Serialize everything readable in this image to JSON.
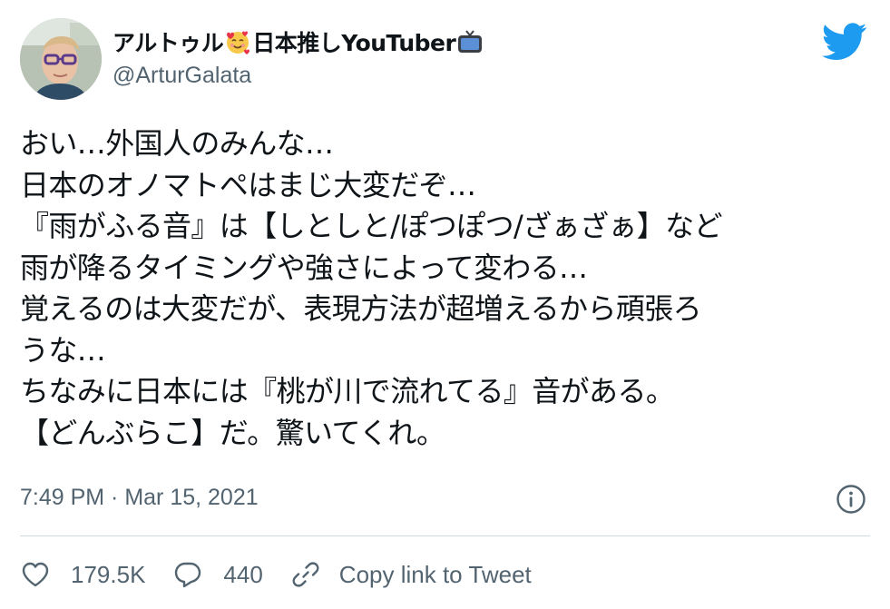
{
  "author": {
    "display_name_prefix": "アルトゥル",
    "display_name_suffix": "日本推しYouTuber",
    "handle": "@ArturGalata",
    "emoji_1": "smiling-face-with-hearts",
    "emoji_2": "television"
  },
  "brand": {
    "icon": "twitter-bird",
    "color": "#1d9bf0"
  },
  "tweet": {
    "lines": [
      "おい…外国人のみんな…",
      "日本のオノマトペはまじ大変だぞ…",
      "『雨がふる音』は【しとしと/ぽつぽつ/ざぁざぁ】など",
      "雨が降るタイミングや強さによって変わる…",
      "覚えるのは大変だが、表現方法が超増えるから頑張ろ",
      "うな…",
      "ちなみに日本には『桃が川で流れてる』音がある。",
      "【どんぶらこ】だ。驚いてくれ。"
    ]
  },
  "meta": {
    "timestamp": "7:49 PM · Mar 15, 2021",
    "info_icon": "info-icon"
  },
  "actions": {
    "likes": "179.5K",
    "replies": "440",
    "copy_link": "Copy link to Tweet"
  }
}
